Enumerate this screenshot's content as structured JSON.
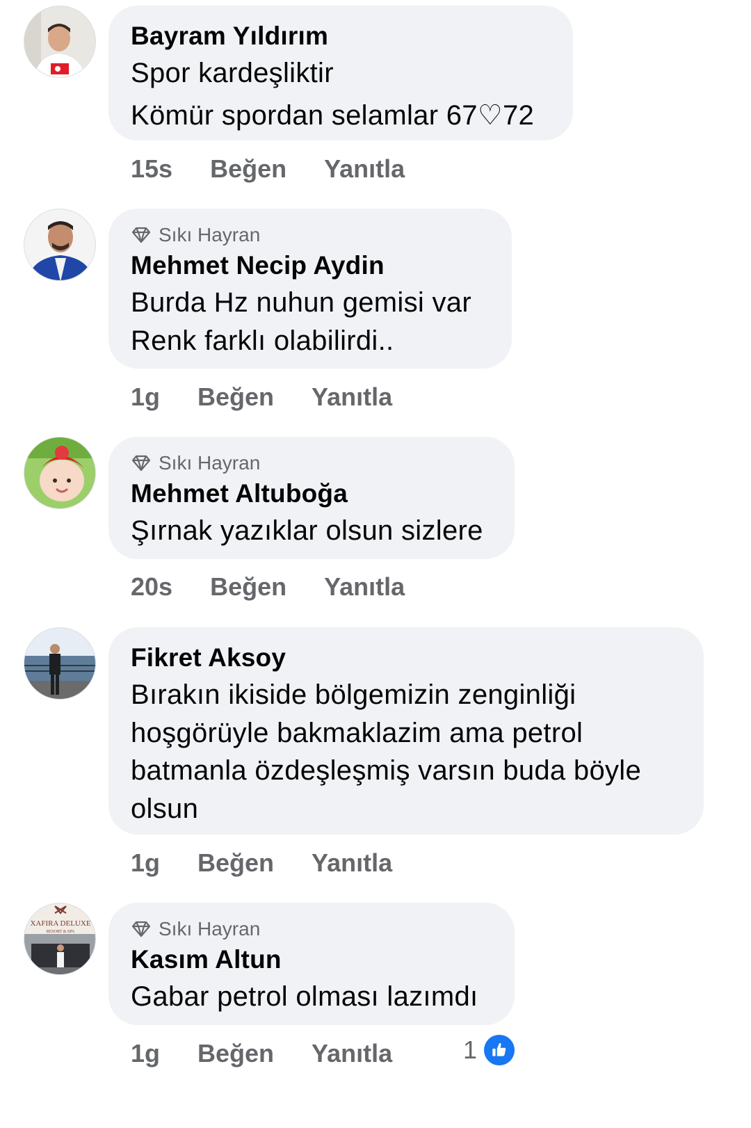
{
  "comments": [
    {
      "author": "Bayram Yıldırım",
      "badge": "",
      "lines": [
        "Spor kardeşliktir",
        "Kömür spordan selamlar 67♡72"
      ],
      "time": "15s",
      "like_label": "Beğen",
      "reply_label": "Yanıtla"
    },
    {
      "author": "Mehmet Necip Aydin",
      "badge": "Sıkı Hayran",
      "lines": [
        "Burda Hz nuhun gemisi var",
        "Renk farklı olabilirdi.."
      ],
      "time": "1g",
      "like_label": "Beğen",
      "reply_label": "Yanıtla"
    },
    {
      "author": "Mehmet Altuboğa",
      "badge": "Sıkı Hayran",
      "lines": [
        "Şırnak yazıklar olsun sizlere"
      ],
      "time": "20s",
      "like_label": "Beğen",
      "reply_label": "Yanıtla"
    },
    {
      "author": "Fikret Aksoy",
      "badge": "",
      "lines": [
        "Bırakın ikiside bölgemizin zenginliği",
        "hoşgörüyle bakmaklazim ama petrol",
        "batmanla özdeşleşmiş varsın buda böyle",
        "olsun"
      ],
      "time": "1g",
      "like_label": "Beğen",
      "reply_label": "Yanıtla"
    },
    {
      "author": "Kasım Altun",
      "badge": "Sıkı Hayran",
      "lines": [
        "Gabar petrol olması lazımdı"
      ],
      "time": "1g",
      "like_label": "Beğen",
      "reply_label": "Yanıtla",
      "reaction_count": "1"
    }
  ],
  "avatar_logo_text": "XAFIRA DELUXE",
  "avatar_logo_sub": "RESORT & SPA",
  "colors": {
    "bubble": "#f0f2f5",
    "meta": "#65676b",
    "like_blue": "#1877f2"
  }
}
